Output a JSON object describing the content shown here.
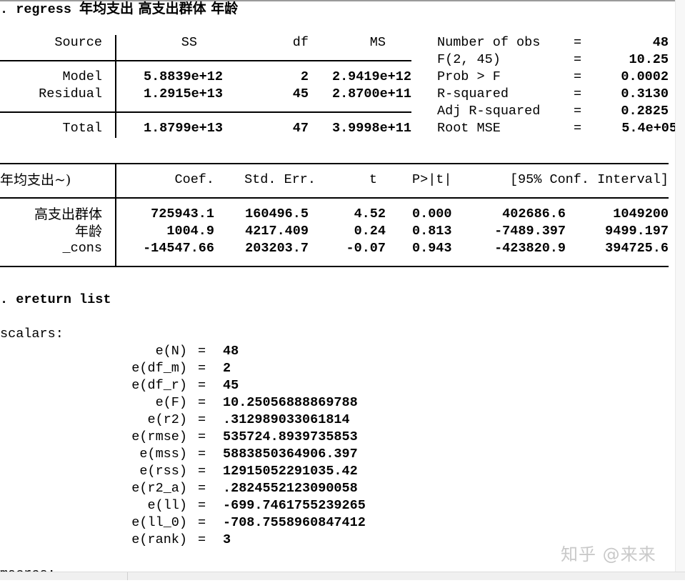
{
  "command1": {
    "prompt": ".",
    "cmd": "regress",
    "args": "年均支出 高支出群体 年龄"
  },
  "anova": {
    "headers": {
      "source": "Source",
      "ss": "SS",
      "df": "df",
      "ms": "MS"
    },
    "rows": [
      {
        "source": "Model",
        "ss": "5.8839e+12",
        "df": "2",
        "ms": "2.9419e+12"
      },
      {
        "source": "Residual",
        "ss": "1.2915e+13",
        "df": "45",
        "ms": "2.8700e+11"
      }
    ],
    "total": {
      "source": "Total",
      "ss": "1.8799e+13",
      "df": "47",
      "ms": "3.9998e+11"
    }
  },
  "stats": [
    {
      "label": "Number of obs",
      "eq": "=",
      "value": "48"
    },
    {
      "label": "F(2, 45)",
      "eq": "=",
      "value": "10.25"
    },
    {
      "label": "Prob > F",
      "eq": "=",
      "value": "0.0002"
    },
    {
      "label": "R-squared",
      "eq": "=",
      "value": "0.3130"
    },
    {
      "label": "Adj R-squared",
      "eq": "=",
      "value": "0.2825"
    },
    {
      "label": "Root MSE",
      "eq": "=",
      "value": "5.4e+05"
    }
  ],
  "coef_table": {
    "headers": {
      "dep": "年均支出~)",
      "coef": "Coef.",
      "se": "Std. Err.",
      "t": "t",
      "p": "P>|t|",
      "ci": "[95% Conf. Interval]"
    },
    "rows": [
      {
        "var": "高支出群体",
        "coef": "725943.1",
        "se": "160496.5",
        "t": "4.52",
        "p": "0.000",
        "lo": "402686.6",
        "hi": "1049200"
      },
      {
        "var": "年龄",
        "coef": "1004.9",
        "se": "4217.409",
        "t": "0.24",
        "p": "0.813",
        "lo": "-7489.397",
        "hi": "9499.197"
      },
      {
        "var": "_cons",
        "coef": "-14547.66",
        "se": "203203.7",
        "t": "-0.07",
        "p": "0.943",
        "lo": "-423820.9",
        "hi": "394725.6"
      }
    ]
  },
  "command2": {
    "prompt": ".",
    "cmd": "ereturn list"
  },
  "scalars": {
    "heading": "scalars:",
    "items": [
      {
        "name": "e(N)",
        "eq": "=",
        "value": "48"
      },
      {
        "name": "e(df_m)",
        "eq": "=",
        "value": "2"
      },
      {
        "name": "e(df_r)",
        "eq": "=",
        "value": "45"
      },
      {
        "name": "e(F)",
        "eq": "=",
        "value": "10.25056888869788"
      },
      {
        "name": "e(r2)",
        "eq": "=",
        "value": ".312989033061814"
      },
      {
        "name": "e(rmse)",
        "eq": "=",
        "value": "535724.8939735853"
      },
      {
        "name": "e(mss)",
        "eq": "=",
        "value": "5883850364906.397"
      },
      {
        "name": "e(rss)",
        "eq": "=",
        "value": "12915052291035.42"
      },
      {
        "name": "e(r2_a)",
        "eq": "=",
        "value": ".2824552123090058"
      },
      {
        "name": "e(ll)",
        "eq": "=",
        "value": "-699.7461755239265"
      },
      {
        "name": "e(ll_0)",
        "eq": "=",
        "value": "-708.7558960847412"
      },
      {
        "name": "e(rank)",
        "eq": "=",
        "value": "3"
      }
    ]
  },
  "macros_heading": "macros:",
  "watermark": "知乎 @来来"
}
